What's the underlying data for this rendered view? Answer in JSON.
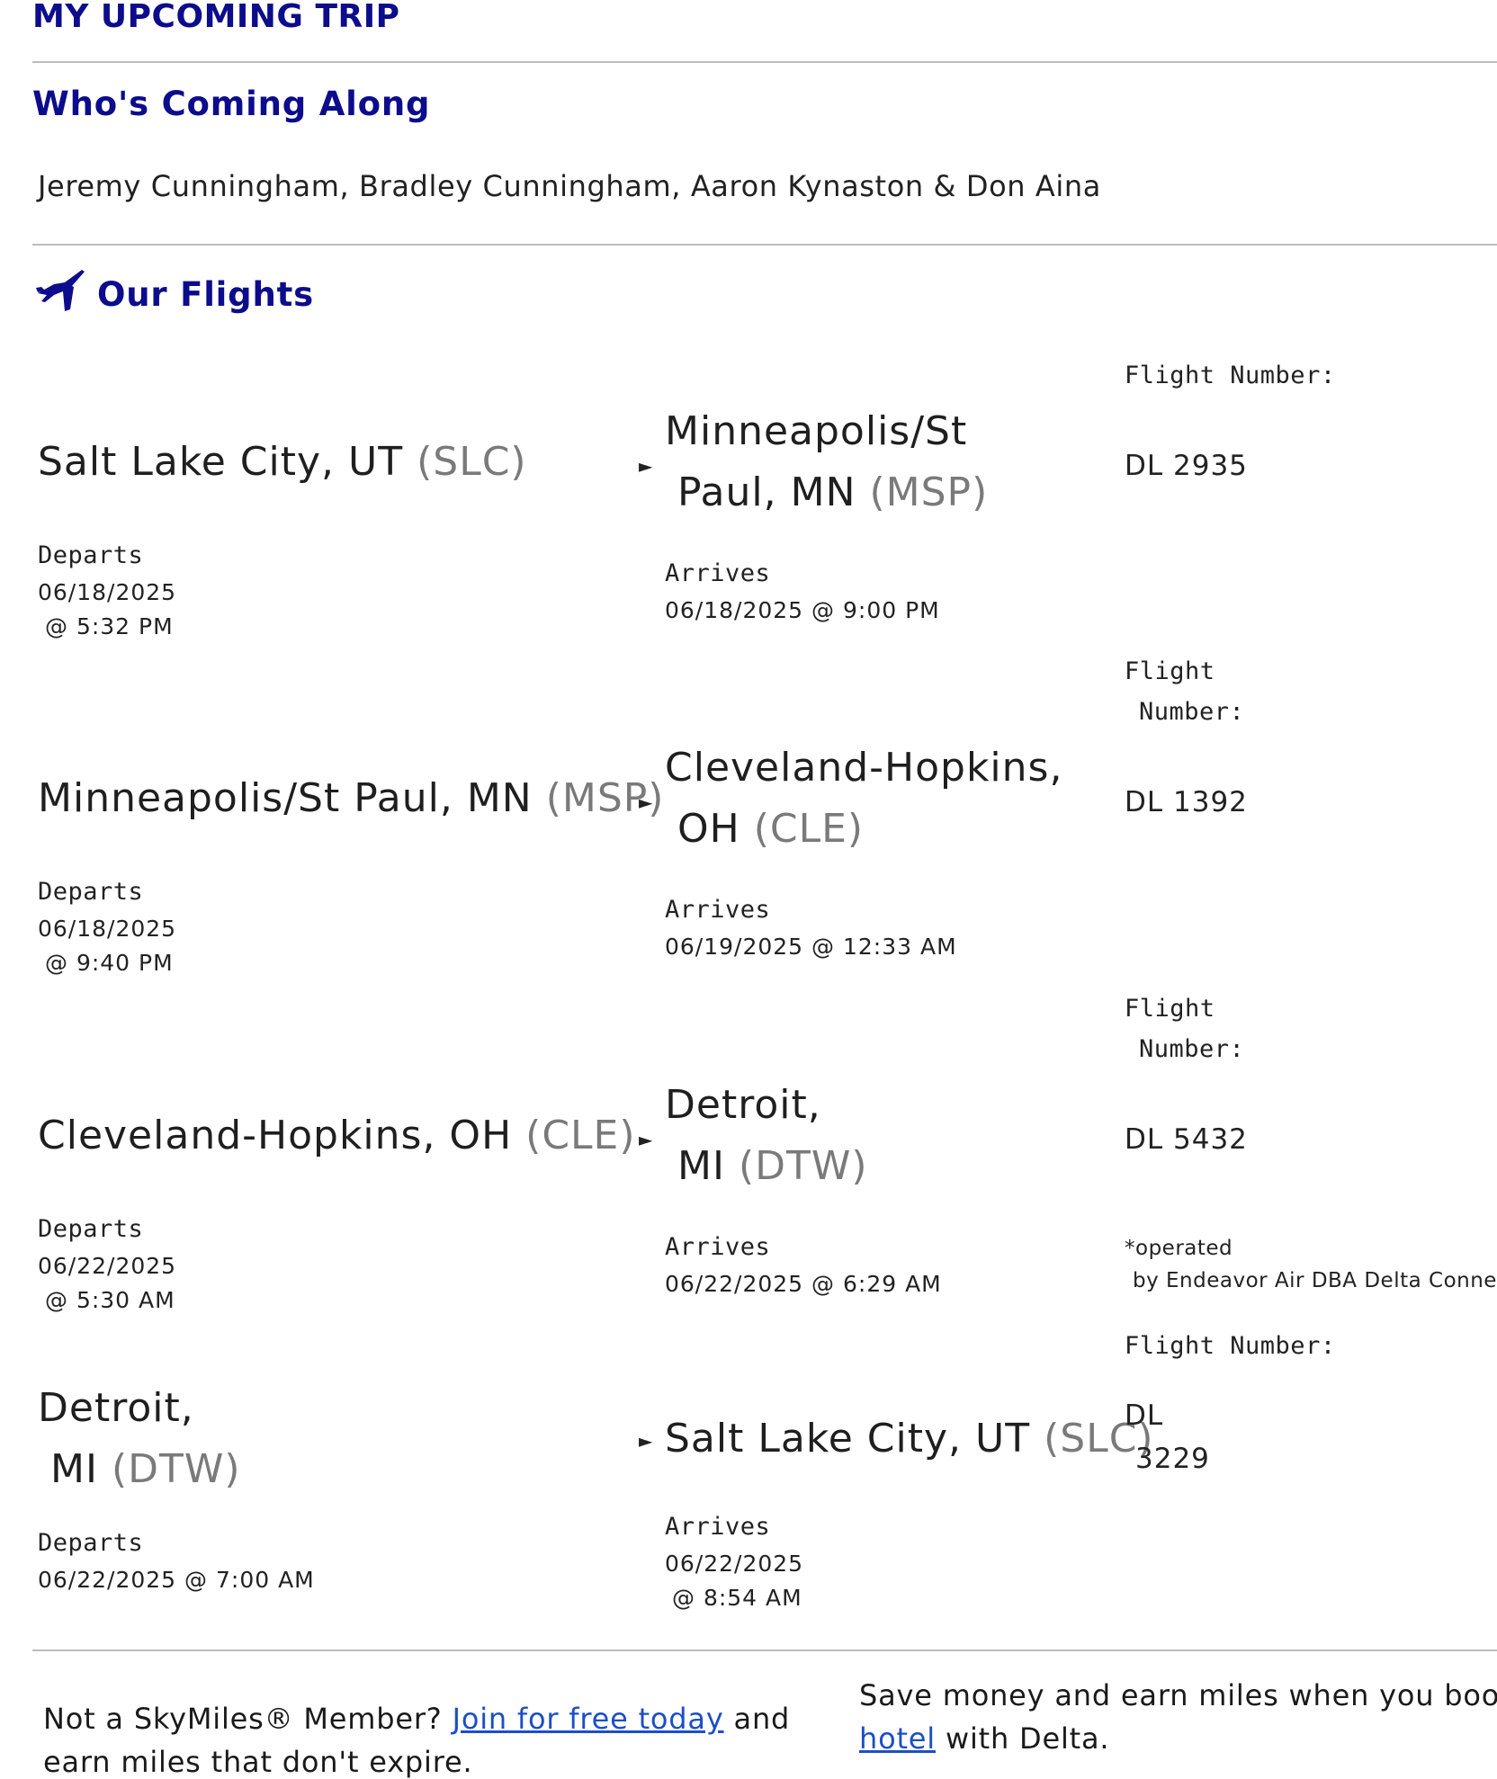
{
  "trip": {
    "title": "MY UPCOMING TRIP",
    "companions_heading": "Who's Coming Along",
    "companions": "Jeremy Cunningham, Bradley Cunningham, Aaron Kynaston & Don Aina",
    "flights_heading": "Our Flights"
  },
  "labels": {
    "departs": "Departs",
    "arrives": "Arrives",
    "flight_number": "Flight Number:",
    "flight_word": "Flight",
    "number_word": "Number:",
    "arrow": "►"
  },
  "flights": [
    {
      "from_city": "Salt Lake City, UT",
      "from_code": "(SLC)",
      "to_city_line1": "Minneapolis/St",
      "to_city_line2": "Paul, MN",
      "to_code": "(MSP)",
      "depart_date": "06/18/2025",
      "depart_time": "@ 5:32 PM",
      "arrive_datetime": "06/18/2025 @ 9:00 PM",
      "flight_number": "DL 2935"
    },
    {
      "from_city": "Minneapolis/St Paul, MN",
      "from_code": "(MSP)",
      "to_city_line1": "Cleveland-Hopkins,",
      "to_city_line2": "OH",
      "to_code": "(CLE)",
      "depart_date": "06/18/2025",
      "depart_time": "@ 9:40 PM",
      "arrive_datetime": "06/19/2025 @ 12:33 AM",
      "flight_number": "DL 1392"
    },
    {
      "from_city": "Cleveland-Hopkins, OH",
      "from_code": "(CLE)",
      "to_city_line1": "Detroit,",
      "to_city_line2": "MI",
      "to_code": "(DTW)",
      "depart_date": "06/22/2025",
      "depart_time": "@ 5:30 AM",
      "arrive_datetime": "06/22/2025 @ 6:29 AM",
      "flight_number": "DL 5432",
      "operated_line1": "*operated",
      "operated_line2": "by Endeavor Air DBA Delta Connection"
    },
    {
      "from_city_line1": "Detroit,",
      "from_city_line2": "MI",
      "from_code": "(DTW)",
      "to_city": "Salt Lake City, UT",
      "to_code": "(SLC)",
      "depart_datetime": "06/22/2025 @ 7:00 AM",
      "arrive_date": "06/22/2025",
      "arrive_time": "@ 8:54 AM",
      "flight_number_line1": "DL",
      "flight_number_line2": "3229"
    }
  ],
  "promos": {
    "skymiles_prefix": "Not a SkyMiles® Member?",
    "skymiles_link": "Join for free today",
    "skymiles_suffix": "and",
    "skymiles_line2": "earn miles that don't expire.",
    "hotel_line1": "Save money and earn miles when you book a",
    "hotel_link": "hotel",
    "hotel_suffix": "with Delta."
  },
  "colors": {
    "heading": "#0c0c8c",
    "airport_code": "#7a7a7a",
    "link": "#1c4fc4",
    "divider": "#bdbdbd"
  }
}
